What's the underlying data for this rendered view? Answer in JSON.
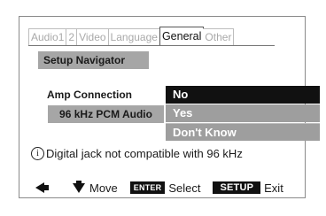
{
  "tabs": [
    "Audio1",
    "2",
    "Video",
    "Language",
    "General",
    "Other"
  ],
  "active_tab": "General",
  "navigator_title": "Setup Navigator",
  "settings": {
    "amp_connection": "Amp Connection",
    "pcm_96k": "96 kHz PCM Audio"
  },
  "options": [
    "No",
    "Yes",
    "Don't Know"
  ],
  "selected_option": "No",
  "info_text": "Digital jack not compatible with 96 kHz",
  "footer": {
    "move_label": "Move",
    "enter_key": "ENTER",
    "select_label": "Select",
    "setup_key": "SETUP",
    "exit_label": "Exit"
  },
  "colors": {
    "selected_bg": "#111111",
    "option_bg": "#9e9e9e",
    "label_bg": "#a6a6a6"
  }
}
